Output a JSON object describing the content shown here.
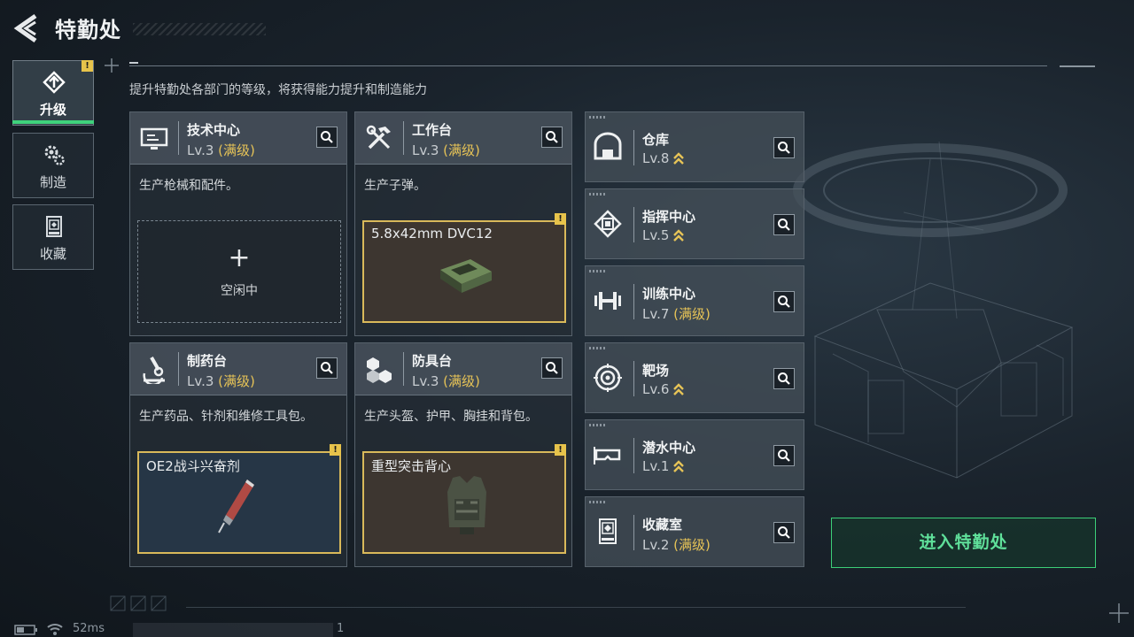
{
  "header": {
    "title": "特勤处"
  },
  "subtitle": "提升特勤处各部门的等级，将获得能力提升和制造能力",
  "nav": [
    {
      "label": "升级",
      "active": true
    },
    {
      "label": "制造",
      "active": false
    },
    {
      "label": "收藏",
      "active": false
    }
  ],
  "badge_mark": "!",
  "max_label": "(满级)",
  "cards": [
    {
      "name": "技术中心",
      "level": "Lv.3",
      "desc": "生产枪械和配件。",
      "slot_status": "空闲中",
      "slot_plus": "+"
    },
    {
      "name": "工作台",
      "level": "Lv.3",
      "desc": "生产子弹。",
      "slot_item": "5.8x42mm DVC12"
    },
    {
      "name": "制药台",
      "level": "Lv.3",
      "desc": "生产药品、针剂和维修工具包。",
      "slot_item": "OE2战斗兴奋剂"
    },
    {
      "name": "防具台",
      "level": "Lv.3",
      "desc": "生产头盔、护甲、胸挂和背包。",
      "slot_item": "重型突击背心"
    }
  ],
  "buildings": [
    {
      "name": "仓库",
      "level": "Lv.8",
      "upgradable": true,
      "icon": "warehouse-icon"
    },
    {
      "name": "指挥中心",
      "level": "Lv.5",
      "upgradable": true,
      "icon": "chip-icon"
    },
    {
      "name": "训练中心",
      "level": "Lv.7",
      "upgradable": false,
      "icon": "dumbbell-icon"
    },
    {
      "name": "靶场",
      "level": "Lv.6",
      "upgradable": true,
      "icon": "target-icon"
    },
    {
      "name": "潜水中心",
      "level": "Lv.1",
      "upgradable": true,
      "icon": "dive-mask-icon"
    },
    {
      "name": "收藏室",
      "level": "Lv.2",
      "upgradable": false,
      "icon": "display-case-icon"
    }
  ],
  "enter_button": "进入特勤处",
  "status_bar": {
    "ping": "52ms",
    "counter": "1"
  },
  "colors": {
    "accent_green": "#3fd27c",
    "gold": "#e6c357",
    "badge": "#e7c34b"
  }
}
